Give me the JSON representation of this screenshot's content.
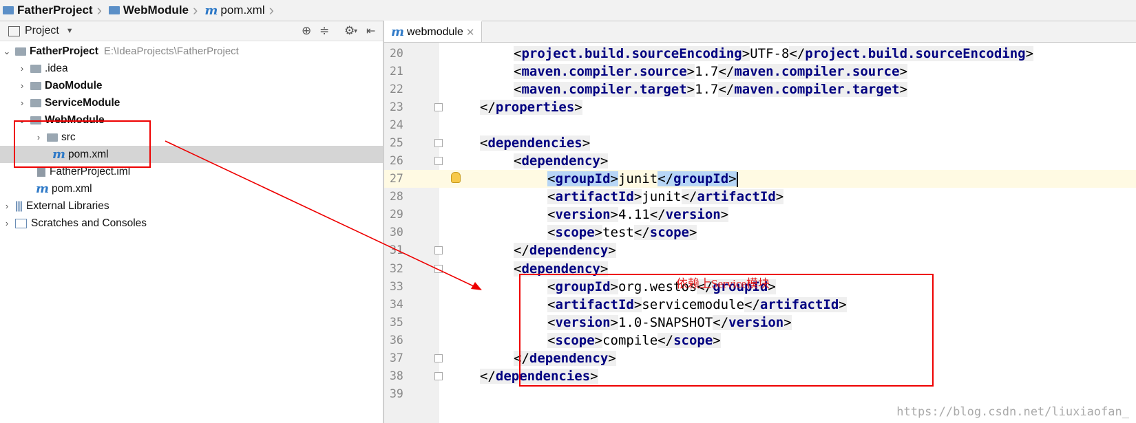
{
  "breadcrumb": [
    "FatherProject",
    "WebModule",
    "pom.xml"
  ],
  "project_panel": {
    "title": "Project",
    "root": {
      "name": "FatherProject",
      "path": "E:\\IdeaProjects\\FatherProject"
    },
    "items": [
      {
        "label": ".idea"
      },
      {
        "label": "DaoModule"
      },
      {
        "label": "ServiceModule"
      },
      {
        "label": "WebModule"
      },
      {
        "label": "src"
      },
      {
        "label": "pom.xml"
      },
      {
        "label": "FatherProject.iml"
      },
      {
        "label": "pom.xml"
      },
      {
        "label": "External Libraries"
      },
      {
        "label": "Scratches and Consoles"
      }
    ]
  },
  "editor": {
    "tab": "webmodule",
    "lines": [
      {
        "no": "20"
      },
      {
        "no": "21"
      },
      {
        "no": "22"
      },
      {
        "no": "23"
      },
      {
        "no": "24"
      },
      {
        "no": "25"
      },
      {
        "no": "26"
      },
      {
        "no": "27"
      },
      {
        "no": "28"
      },
      {
        "no": "29"
      },
      {
        "no": "30"
      },
      {
        "no": "31"
      },
      {
        "no": "32"
      },
      {
        "no": "33"
      },
      {
        "no": "34"
      },
      {
        "no": "35"
      },
      {
        "no": "36"
      },
      {
        "no": "37"
      },
      {
        "no": "38"
      },
      {
        "no": "39"
      }
    ],
    "values": {
      "encoding": "UTF-8",
      "src": "1.7",
      "tgt": "1.7",
      "junit_group": "junit",
      "junit_artifact": "junit",
      "junit_version": "4.11",
      "junit_scope": "test",
      "svc_group": "org.westos",
      "svc_artifact": "servicemodule",
      "svc_version": "1.0-SNAPSHOT",
      "svc_scope": "compile"
    }
  },
  "annotation": "依赖上Service模块",
  "watermark": "https://blog.csdn.net/liuxiaofan_"
}
